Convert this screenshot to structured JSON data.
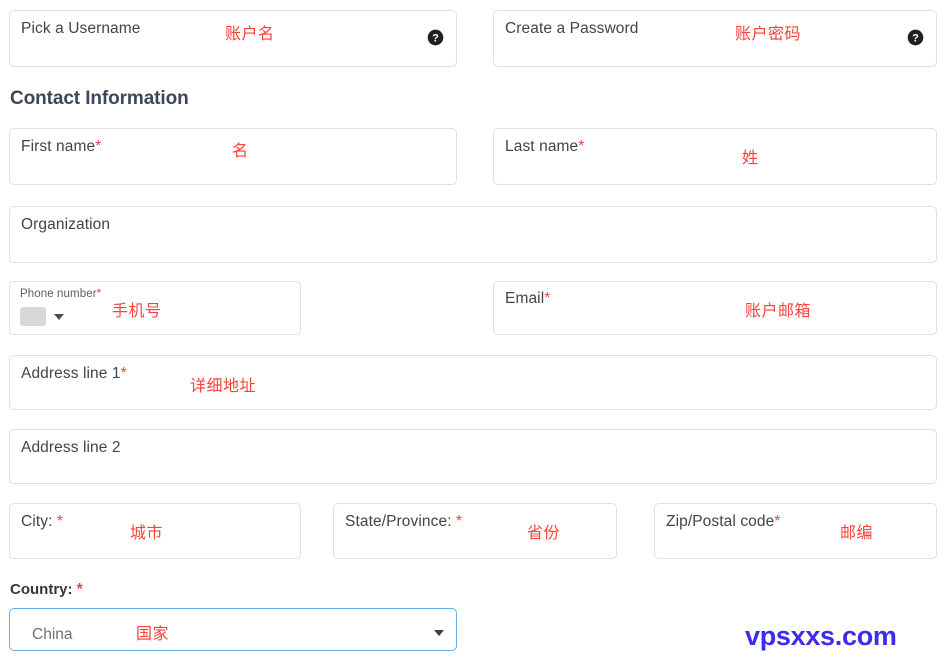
{
  "section": {
    "heading": "Contact Information"
  },
  "fields": {
    "username": {
      "label": "Pick a Username",
      "annotation": "账户名",
      "help_icon": "help-circle-icon"
    },
    "password": {
      "label": "Create a Password",
      "annotation": "账户密码",
      "help_icon": "help-circle-icon"
    },
    "first_name": {
      "label": "First name",
      "required_mark": "*",
      "annotation": "名"
    },
    "last_name": {
      "label": "Last name",
      "required_mark": "*",
      "annotation": "姓"
    },
    "organization": {
      "label": "Organization",
      "annotation": ""
    },
    "phone": {
      "label": "Phone number",
      "required_mark": "*",
      "annotation": "手机号",
      "flag_icon": "country-flag-placeholder",
      "caret_icon": "chevron-down-icon"
    },
    "email": {
      "label": "Email",
      "required_mark": "*",
      "annotation": "账户邮箱"
    },
    "address1": {
      "label": "Address line 1",
      "required_mark": "*",
      "annotation": "详细地址"
    },
    "address2": {
      "label": "Address line 2",
      "annotation": ""
    },
    "city": {
      "label": "City: ",
      "required_mark": "*",
      "annotation": "城市"
    },
    "state": {
      "label": "State/Province: ",
      "required_mark": "*",
      "annotation": "省份"
    },
    "zip": {
      "label": "Zip/Postal code",
      "required_mark": "*",
      "annotation": "邮编"
    },
    "country": {
      "label": "Country: ",
      "required_mark": "*",
      "value": "China",
      "annotation": "国家",
      "caret_icon": "chevron-down-icon"
    }
  },
  "watermark": {
    "text": "vpsxxs.com"
  },
  "colors": {
    "annotation_red": "#f9423a",
    "required_red": "#e8433a",
    "border_grey": "#e0e0e0",
    "focus_blue": "#62b0e8",
    "heading_slate": "#3c4858",
    "watermark_blue": "#3d2bf0"
  }
}
